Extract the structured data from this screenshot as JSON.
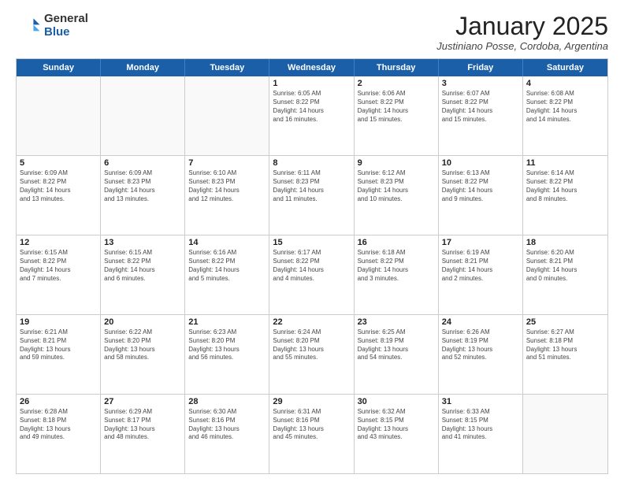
{
  "logo": {
    "general": "General",
    "blue": "Blue"
  },
  "header": {
    "month": "January 2025",
    "location": "Justiniano Posse, Cordoba, Argentina"
  },
  "weekdays": [
    "Sunday",
    "Monday",
    "Tuesday",
    "Wednesday",
    "Thursday",
    "Friday",
    "Saturday"
  ],
  "rows": [
    [
      {
        "day": "",
        "info": ""
      },
      {
        "day": "",
        "info": ""
      },
      {
        "day": "",
        "info": ""
      },
      {
        "day": "1",
        "info": "Sunrise: 6:05 AM\nSunset: 8:22 PM\nDaylight: 14 hours\nand 16 minutes."
      },
      {
        "day": "2",
        "info": "Sunrise: 6:06 AM\nSunset: 8:22 PM\nDaylight: 14 hours\nand 15 minutes."
      },
      {
        "day": "3",
        "info": "Sunrise: 6:07 AM\nSunset: 8:22 PM\nDaylight: 14 hours\nand 15 minutes."
      },
      {
        "day": "4",
        "info": "Sunrise: 6:08 AM\nSunset: 8:22 PM\nDaylight: 14 hours\nand 14 minutes."
      }
    ],
    [
      {
        "day": "5",
        "info": "Sunrise: 6:09 AM\nSunset: 8:22 PM\nDaylight: 14 hours\nand 13 minutes."
      },
      {
        "day": "6",
        "info": "Sunrise: 6:09 AM\nSunset: 8:23 PM\nDaylight: 14 hours\nand 13 minutes."
      },
      {
        "day": "7",
        "info": "Sunrise: 6:10 AM\nSunset: 8:23 PM\nDaylight: 14 hours\nand 12 minutes."
      },
      {
        "day": "8",
        "info": "Sunrise: 6:11 AM\nSunset: 8:23 PM\nDaylight: 14 hours\nand 11 minutes."
      },
      {
        "day": "9",
        "info": "Sunrise: 6:12 AM\nSunset: 8:23 PM\nDaylight: 14 hours\nand 10 minutes."
      },
      {
        "day": "10",
        "info": "Sunrise: 6:13 AM\nSunset: 8:22 PM\nDaylight: 14 hours\nand 9 minutes."
      },
      {
        "day": "11",
        "info": "Sunrise: 6:14 AM\nSunset: 8:22 PM\nDaylight: 14 hours\nand 8 minutes."
      }
    ],
    [
      {
        "day": "12",
        "info": "Sunrise: 6:15 AM\nSunset: 8:22 PM\nDaylight: 14 hours\nand 7 minutes."
      },
      {
        "day": "13",
        "info": "Sunrise: 6:15 AM\nSunset: 8:22 PM\nDaylight: 14 hours\nand 6 minutes."
      },
      {
        "day": "14",
        "info": "Sunrise: 6:16 AM\nSunset: 8:22 PM\nDaylight: 14 hours\nand 5 minutes."
      },
      {
        "day": "15",
        "info": "Sunrise: 6:17 AM\nSunset: 8:22 PM\nDaylight: 14 hours\nand 4 minutes."
      },
      {
        "day": "16",
        "info": "Sunrise: 6:18 AM\nSunset: 8:22 PM\nDaylight: 14 hours\nand 3 minutes."
      },
      {
        "day": "17",
        "info": "Sunrise: 6:19 AM\nSunset: 8:21 PM\nDaylight: 14 hours\nand 2 minutes."
      },
      {
        "day": "18",
        "info": "Sunrise: 6:20 AM\nSunset: 8:21 PM\nDaylight: 14 hours\nand 0 minutes."
      }
    ],
    [
      {
        "day": "19",
        "info": "Sunrise: 6:21 AM\nSunset: 8:21 PM\nDaylight: 13 hours\nand 59 minutes."
      },
      {
        "day": "20",
        "info": "Sunrise: 6:22 AM\nSunset: 8:20 PM\nDaylight: 13 hours\nand 58 minutes."
      },
      {
        "day": "21",
        "info": "Sunrise: 6:23 AM\nSunset: 8:20 PM\nDaylight: 13 hours\nand 56 minutes."
      },
      {
        "day": "22",
        "info": "Sunrise: 6:24 AM\nSunset: 8:20 PM\nDaylight: 13 hours\nand 55 minutes."
      },
      {
        "day": "23",
        "info": "Sunrise: 6:25 AM\nSunset: 8:19 PM\nDaylight: 13 hours\nand 54 minutes."
      },
      {
        "day": "24",
        "info": "Sunrise: 6:26 AM\nSunset: 8:19 PM\nDaylight: 13 hours\nand 52 minutes."
      },
      {
        "day": "25",
        "info": "Sunrise: 6:27 AM\nSunset: 8:18 PM\nDaylight: 13 hours\nand 51 minutes."
      }
    ],
    [
      {
        "day": "26",
        "info": "Sunrise: 6:28 AM\nSunset: 8:18 PM\nDaylight: 13 hours\nand 49 minutes."
      },
      {
        "day": "27",
        "info": "Sunrise: 6:29 AM\nSunset: 8:17 PM\nDaylight: 13 hours\nand 48 minutes."
      },
      {
        "day": "28",
        "info": "Sunrise: 6:30 AM\nSunset: 8:16 PM\nDaylight: 13 hours\nand 46 minutes."
      },
      {
        "day": "29",
        "info": "Sunrise: 6:31 AM\nSunset: 8:16 PM\nDaylight: 13 hours\nand 45 minutes."
      },
      {
        "day": "30",
        "info": "Sunrise: 6:32 AM\nSunset: 8:15 PM\nDaylight: 13 hours\nand 43 minutes."
      },
      {
        "day": "31",
        "info": "Sunrise: 6:33 AM\nSunset: 8:15 PM\nDaylight: 13 hours\nand 41 minutes."
      },
      {
        "day": "",
        "info": ""
      }
    ]
  ]
}
